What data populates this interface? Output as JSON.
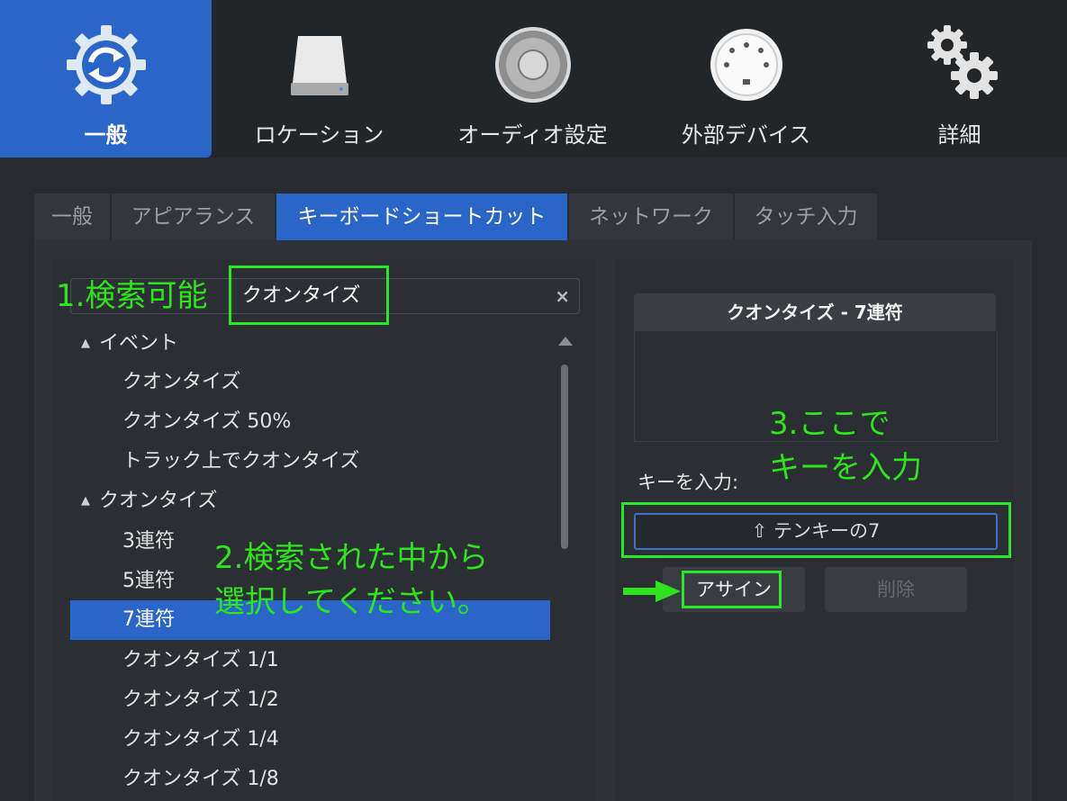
{
  "toolbar": {
    "items": [
      {
        "label": "一般",
        "icon": "gear-sync-icon",
        "active": true
      },
      {
        "label": "ロケーション",
        "icon": "drive-icon"
      },
      {
        "label": "オーディオ設定",
        "icon": "speaker-icon"
      },
      {
        "label": "外部デバイス",
        "icon": "midi-port-icon"
      },
      {
        "label": "詳細",
        "icon": "gears-icon"
      }
    ]
  },
  "tabs": [
    {
      "label": "一般"
    },
    {
      "label": "アピアランス"
    },
    {
      "label": "キーボードショートカット",
      "active": true
    },
    {
      "label": "ネットワーク"
    },
    {
      "label": "タッチ入力"
    }
  ],
  "search": {
    "value": "クオンタイズ",
    "clear_glyph": "×"
  },
  "tree": [
    {
      "label": "イベント"
    },
    {
      "label": "クオンタイズ"
    },
    {
      "label": "クオンタイズ 50%"
    },
    {
      "label": "トラック上でクオンタイズ"
    },
    {
      "label": "クオンタイズ"
    },
    {
      "label": "3連符"
    },
    {
      "label": "5連符"
    },
    {
      "label": "7連符"
    },
    {
      "label": "クオンタイズ 1/1"
    },
    {
      "label": "クオンタイズ 1/2"
    },
    {
      "label": "クオンタイズ 1/4"
    },
    {
      "label": "クオンタイズ 1/8"
    }
  ],
  "detail": {
    "title": "クオンタイズ - 7連符",
    "key_label": "キーを入力:",
    "key_value": "⇧ テンキーの7",
    "assign_label": "アサイン",
    "delete_label": "削除"
  },
  "annotations": {
    "search_note": "1.検索可能",
    "select_note_line1": "2.検索された中から",
    "select_note_line2": "選択してください。",
    "key_note_line1": "3.ここで",
    "key_note_line2": "キーを入力"
  },
  "colors": {
    "accent": "#2a66c8",
    "annotation": "#2ee51d"
  }
}
